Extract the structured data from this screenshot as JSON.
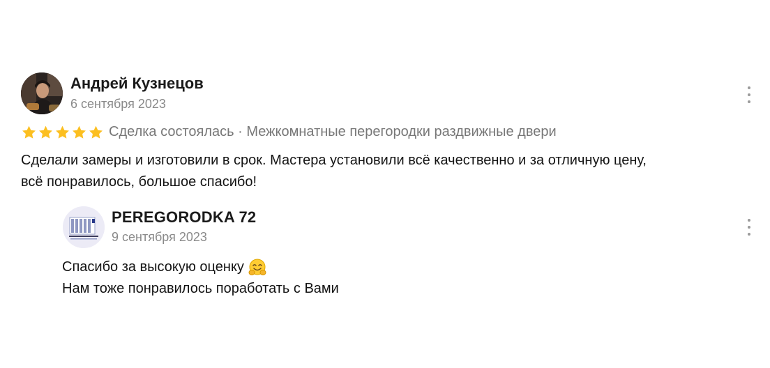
{
  "review": {
    "author_name": "Андрей Кузнецов",
    "date": "6 сентября 2023",
    "rating": 5,
    "rating_max": 5,
    "star_color": "#fcbf20",
    "meta": "Сделка состоялась · Межкомнатные перегородки раздвижные двери",
    "text_lines": [
      "Сделали замеры и изготовили в срок. Мастера установили всё качественно и за отличную цену,",
      "всё понравилось, большое спасибо!"
    ]
  },
  "reply": {
    "company_name": "PEREGORODKA 72",
    "date": "9 сентября 2023",
    "text_lines": [
      "Спасибо за высокую оценку",
      "Нам тоже понравилось поработать с Вами"
    ],
    "emoji": "smiling-face-with-open-hands-icon"
  },
  "icons": {
    "more": "more-vertical-icon",
    "star": "star-icon"
  }
}
